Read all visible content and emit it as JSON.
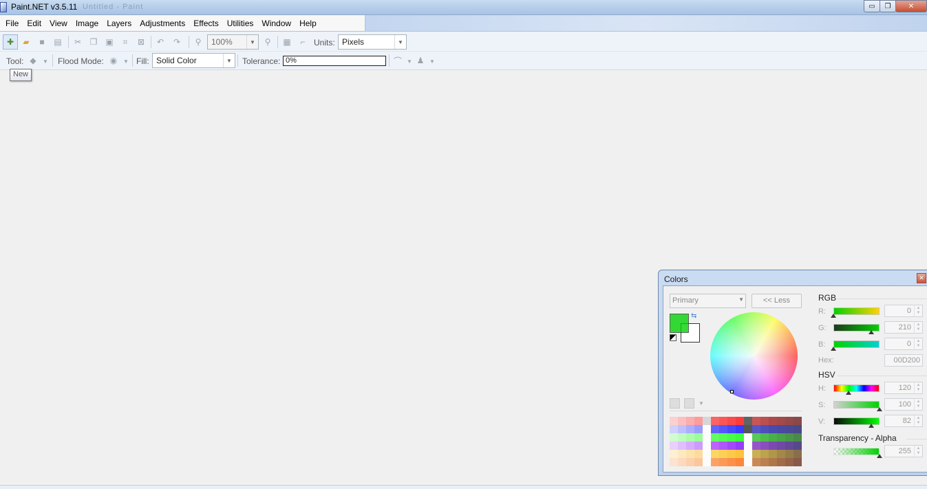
{
  "window": {
    "title": "Paint.NET v3.5.11",
    "blurred_title": "Untitled - Paint",
    "controls": {
      "minimize": "▭",
      "maximize": "❐",
      "close": "✕"
    }
  },
  "menu": [
    "File",
    "Edit",
    "View",
    "Image",
    "Layers",
    "Adjustments",
    "Effects",
    "Utilities",
    "Window",
    "Help"
  ],
  "toolbar": {
    "zoom_value": "100%",
    "units_label": "Units:",
    "units_value": "Pixels",
    "tool_label": "Tool:",
    "flood_mode_label": "Flood Mode:",
    "fill_label": "Fill:",
    "fill_value": "Solid Color",
    "tolerance_label": "Tolerance:",
    "tolerance_value": "0%",
    "tooltip": "New"
  },
  "colors_window": {
    "title": "Colors",
    "close": "✕",
    "primary_select": "Primary",
    "less_button": "<< Less",
    "primary_color": "#00D200",
    "secondary_color": "#FFFFFF",
    "rgb_header": "RGB",
    "r_label": "R:",
    "r_value": "0",
    "g_label": "G:",
    "g_value": "210",
    "b_label": "B:",
    "b_value": "0",
    "hex_label": "Hex:",
    "hex_value": "00D200",
    "hsv_header": "HSV",
    "h_label": "H:",
    "h_value": "120",
    "s_label": "S:",
    "s_value": "100",
    "v_label": "V:",
    "v_value": "82",
    "alpha_header": "Transparency - Alpha",
    "alpha_value": "255"
  }
}
